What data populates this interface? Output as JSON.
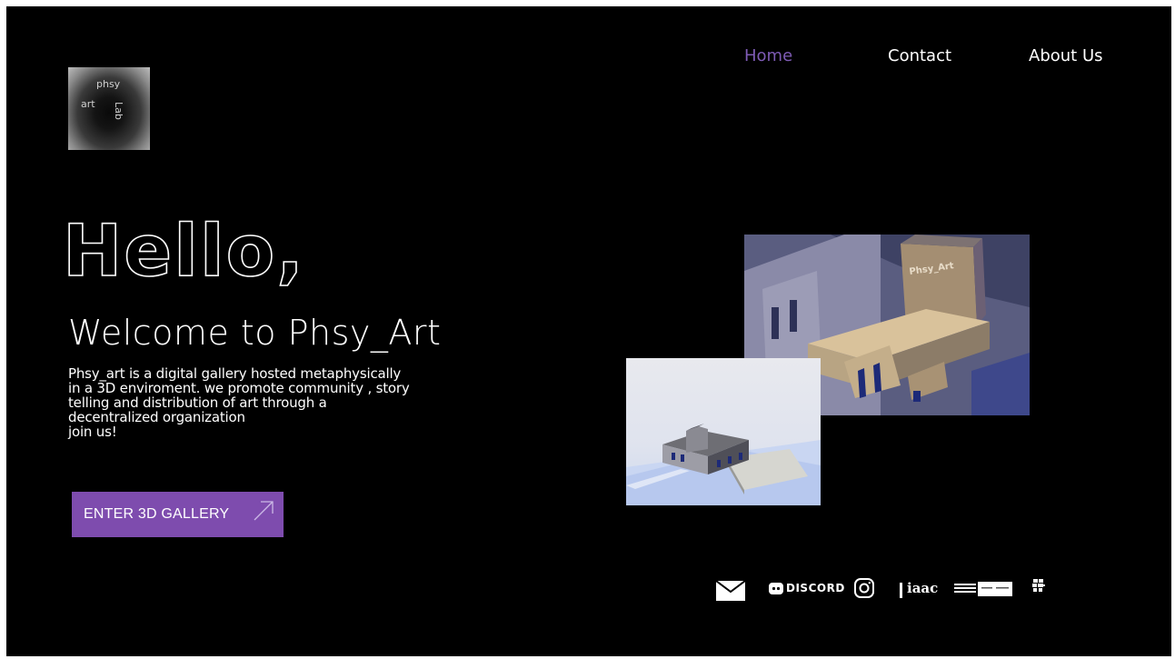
{
  "brand": {
    "logo_words": [
      "phsy",
      "art",
      "Lab"
    ]
  },
  "nav": {
    "items": [
      {
        "label": "Home",
        "active": true
      },
      {
        "label": "Contact",
        "active": false
      },
      {
        "label": "About Us",
        "active": false
      }
    ],
    "active_color": "#7e5bb5"
  },
  "hero": {
    "greeting": "Hello,",
    "title": "Welcome to Phsy_Art",
    "description": "Phsy_art is a digital gallery hosted metaphysically\nin a 3D enviroment. we promote community , story\ntelling and distribution of art through a\ndecentralized organization\njoin us!",
    "cta_label": "ENTER 3D GALLERY",
    "cta_icon": "arrow-up-right-icon"
  },
  "gallery": {
    "building_sign": "Phsy_Art"
  },
  "socials": {
    "items": [
      {
        "name": "mail-icon"
      },
      {
        "name": "discord-icon",
        "text": "DISCORD"
      },
      {
        "name": "instagram-icon"
      },
      {
        "name": "iaac-logo-icon",
        "text": "iaac"
      },
      {
        "name": "grid-icon"
      }
    ]
  },
  "colors": {
    "background": "#000000",
    "accent": "#7e4cae",
    "text": "#ffffff"
  }
}
